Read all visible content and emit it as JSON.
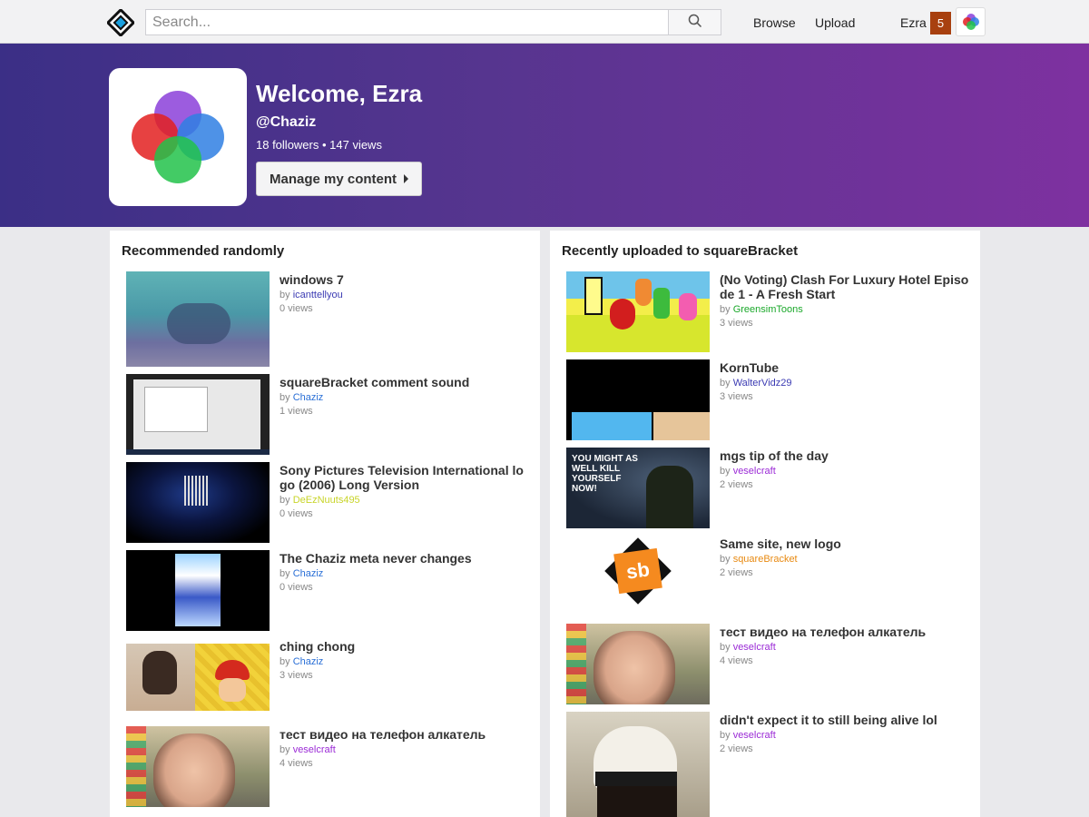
{
  "header": {
    "search_placeholder": "Search...",
    "nav": {
      "browse": "Browse",
      "upload": "Upload"
    },
    "user_name": "Ezra",
    "notification_count": "5"
  },
  "hero": {
    "title": "Welcome, Ezra",
    "handle": "@Chaziz",
    "stats": "18 followers • 147 views",
    "manage_button": "Manage my content"
  },
  "recommended": {
    "title": "Recommended randomly",
    "videos": [
      {
        "title": "windows 7",
        "by": "by",
        "author": "icanttellyou",
        "author_color": "#3b3bb3",
        "views": "0 views"
      },
      {
        "title": "squareBracket comment sound",
        "by": "by",
        "author": "Chaziz",
        "author_color": "#2a6fd6",
        "views": "1 views"
      },
      {
        "title": "Sony Pictures Television International logo (2006) Long Version",
        "by": "by",
        "author": "DeEzNuuts495",
        "author_color": "#c8d428",
        "views": "0 views"
      },
      {
        "title": "The Chaziz meta never changes",
        "by": "by",
        "author": "Chaziz",
        "author_color": "#2a6fd6",
        "views": "0 views"
      },
      {
        "title": "ching chong",
        "by": "by",
        "author": "Chaziz",
        "author_color": "#2a6fd6",
        "views": "3 views"
      },
      {
        "title": "тест видео на телефон алкатель",
        "by": "by",
        "author": "veselcraft",
        "author_color": "#9b2bd6",
        "views": "4 views"
      }
    ]
  },
  "recent": {
    "title": "Recently uploaded to squareBracket",
    "videos": [
      {
        "title": "(No Voting) Clash For Luxury Hotel Episode 1 - A Fresh Start",
        "by": "by",
        "author": "GreensimToons",
        "author_color": "#1aa82a",
        "views": "3 views"
      },
      {
        "title": "KornTube",
        "by": "by",
        "author": "WalterVidz29",
        "author_color": "#3b3bb3",
        "views": "3 views"
      },
      {
        "title": "mgs tip of the day",
        "by": "by",
        "author": "veselcraft",
        "author_color": "#9b2bd6",
        "views": "2 views",
        "thumb_text": "YOU MIGHT AS WELL KILL YOURSELF NOW!"
      },
      {
        "title": "Same site, new logo",
        "by": "by",
        "author": "squareBracket",
        "author_color": "#e88a12",
        "views": "2 views",
        "thumb_text": "sb"
      },
      {
        "title": "тест видео на телефон алкатель",
        "by": "by",
        "author": "veselcraft",
        "author_color": "#9b2bd6",
        "views": "4 views"
      },
      {
        "title": "didn't expect it to still being alive lol",
        "by": "by",
        "author": "veselcraft",
        "author_color": "#9b2bd6",
        "views": "2 views"
      }
    ]
  },
  "colors": {
    "hero_gradient_start": "#3b2f86",
    "hero_gradient_end": "#7e31a0",
    "badge": "#a8400f"
  }
}
